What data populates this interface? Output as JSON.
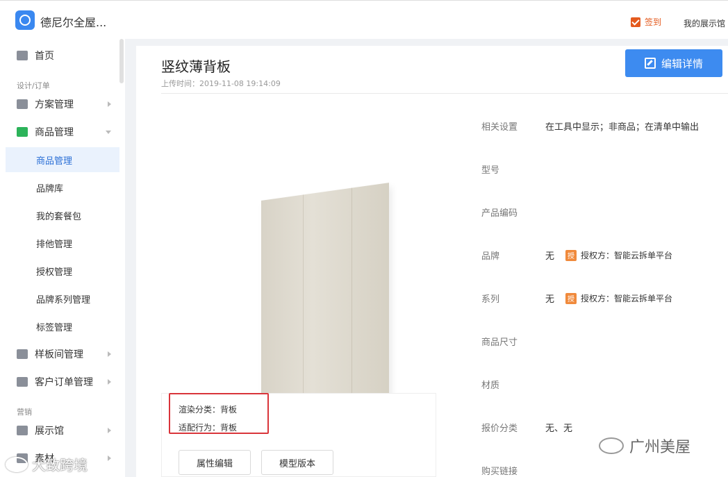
{
  "header": {
    "company": "德尼尔全屋...",
    "checkin_label": "签到",
    "showroom_link": "我的展示馆"
  },
  "sidebar": {
    "home": "首页",
    "group_design": "设计/订单",
    "plans": "方案管理",
    "goods": "商品管理",
    "sub_items": [
      "商品管理",
      "品牌库",
      "我的套餐包",
      "排他管理",
      "授权管理",
      "品牌系列管理",
      "标签管理"
    ],
    "samples": "样板间管理",
    "orders": "客户订单管理",
    "group_marketing": "营销",
    "exhibition": "展示馆",
    "partial": "素材"
  },
  "product": {
    "title": "竖纹薄背板",
    "upload_time": "上传时间：2019-11-08 19:14:09",
    "edit_button": "编辑详情",
    "render_category": "渲染分类：背板",
    "adapt_behavior": "适配行为：背板",
    "attr_edit_button": "属性编辑",
    "model_version_button": "模型版本"
  },
  "attributes": [
    {
      "label": "相关设置",
      "value": "在工具中显示；非商品；在清单中输出"
    },
    {
      "label": "型号",
      "value": ""
    },
    {
      "label": "产品编码",
      "value": ""
    },
    {
      "label": "品牌",
      "value": "无",
      "auth": "授权方：智能云拆单平台"
    },
    {
      "label": "系列",
      "value": "无",
      "auth": "授权方：智能云拆单平台"
    },
    {
      "label": "商品尺寸",
      "value": ""
    },
    {
      "label": "材质",
      "value": ""
    },
    {
      "label": "报价分类",
      "value": "无、无"
    },
    {
      "label": "购买链接",
      "value": ""
    }
  ],
  "auth_badge": "授",
  "watermarks": {
    "right": "广州美屋",
    "left": "大致跨境"
  },
  "colors": {
    "accent": "#3d8bf0",
    "highlight_border": "#d9343a",
    "checkin": "#e45a1e",
    "auth_badge": "#f08a3c"
  }
}
